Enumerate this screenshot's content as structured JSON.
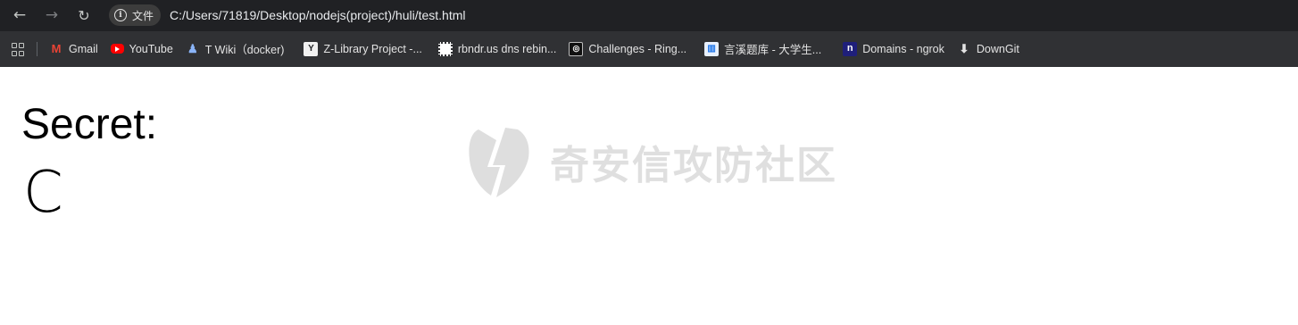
{
  "browser": {
    "chip_label": "文件",
    "url": "C:/Users/71819/Desktop/nodejs(project)/huli/test.html"
  },
  "bookmarks": [
    {
      "label": "Gmail",
      "icon": "gmail-icon"
    },
    {
      "label": "YouTube",
      "icon": "youtube-icon"
    },
    {
      "label": "T Wiki（docker)",
      "icon": "twiki-icon"
    },
    {
      "label": "Z-Library Project -...",
      "icon": "zlibrary-icon"
    },
    {
      "label": "rbndr.us dns rebin...",
      "icon": "rbndr-icon"
    },
    {
      "label": "Challenges - Ring...",
      "icon": "ring-icon"
    },
    {
      "label": "言溪题库 - 大学生...",
      "icon": "book-icon"
    },
    {
      "label": "Domains - ngrok",
      "icon": "ngrok-icon"
    },
    {
      "label": "DownGit",
      "icon": "download-icon"
    }
  ],
  "page": {
    "label": "Secret:",
    "value": "C"
  },
  "watermark": {
    "text": "奇安信攻防社区"
  },
  "colors": {
    "toolbar_bg": "#202124",
    "bookmarks_bg": "#303134",
    "watermark": "#dadada"
  }
}
